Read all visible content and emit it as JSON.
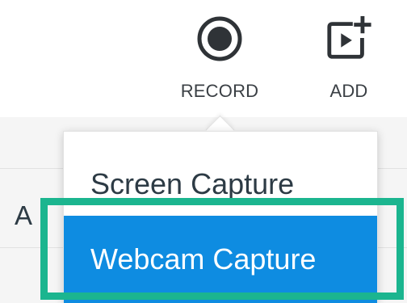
{
  "toolbar": {
    "record": {
      "label": "RECORD",
      "icon": "record-icon"
    },
    "add": {
      "label": "ADD",
      "icon": "add-media-icon"
    }
  },
  "page": {
    "row_text": "A"
  },
  "menu": {
    "items": [
      {
        "label": "Screen Capture",
        "selected": false
      },
      {
        "label": "Webcam Capture",
        "selected": true
      }
    ]
  },
  "colors": {
    "selected_bg": "#0e8ce1",
    "highlight_border": "#1bb58f",
    "text_dark": "#2d3b45",
    "icon_dark": "#2f3337"
  }
}
